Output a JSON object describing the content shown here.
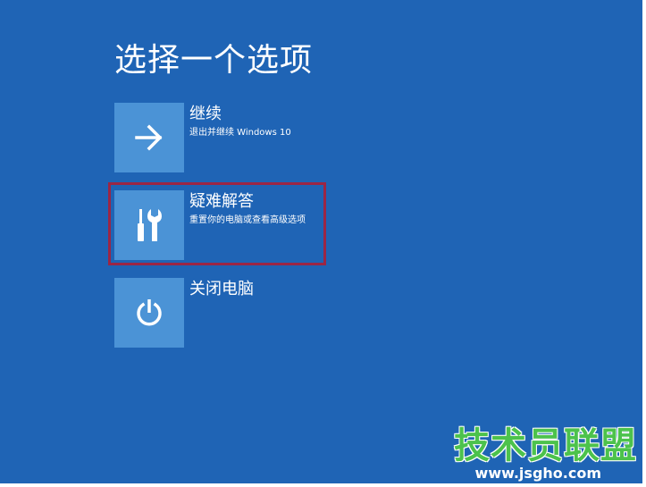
{
  "screen": {
    "title": "选择一个选项",
    "background_color": "#1f64b5",
    "tile_color": "#4b93d6",
    "highlight_color": "#9b2645"
  },
  "options": [
    {
      "label": "继续",
      "description": "退出并继续 Windows 10",
      "icon": "arrow-right-icon"
    },
    {
      "label": "疑难解答",
      "description": "重置你的电脑或查看高级选项",
      "icon": "screwdriver-wrench-icon"
    },
    {
      "label": "关闭电脑",
      "description": "",
      "icon": "power-icon"
    }
  ],
  "watermark": {
    "text": "技术员联盟",
    "url": "www.jsgho.com",
    "brand_color": "#4cc24c"
  }
}
